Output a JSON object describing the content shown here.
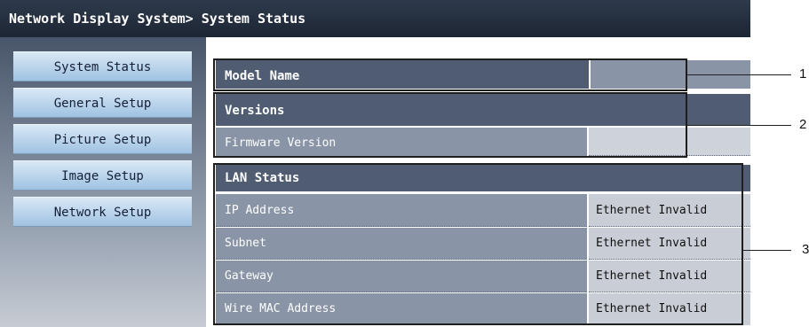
{
  "header": {
    "title": "Network Display System> System Status"
  },
  "sidebar": {
    "items": [
      {
        "label": "System Status"
      },
      {
        "label": "General Setup"
      },
      {
        "label": "Picture Setup"
      },
      {
        "label": "Image Setup"
      },
      {
        "label": "Network Setup"
      }
    ]
  },
  "model": {
    "label": "Model Name",
    "value": ""
  },
  "versions": {
    "title": "Versions",
    "firmware_label": "Firmware Version",
    "firmware_value": ""
  },
  "lan": {
    "title": "LAN Status",
    "rows": [
      {
        "label": "IP Address",
        "value": "Ethernet Invalid"
      },
      {
        "label": "Subnet",
        "value": "Ethernet Invalid"
      },
      {
        "label": "Gateway",
        "value": "Ethernet Invalid"
      },
      {
        "label": "Wire MAC Address",
        "value": "Ethernet Invalid"
      }
    ]
  },
  "callouts": [
    "1",
    "2",
    "3"
  ]
}
